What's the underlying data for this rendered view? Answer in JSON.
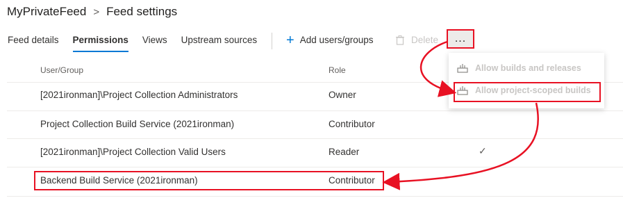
{
  "breadcrumb": {
    "feed": "MyPrivateFeed",
    "separator": ">",
    "page": "Feed settings"
  },
  "tabs": [
    {
      "label": "Feed details"
    },
    {
      "label": "Permissions",
      "active": true
    },
    {
      "label": "Views"
    },
    {
      "label": "Upstream sources"
    }
  ],
  "toolbar": {
    "add_label": "Add users/groups",
    "delete_label": "Delete",
    "more_label": "..."
  },
  "table": {
    "headers": {
      "user": "User/Group",
      "role": "Role"
    },
    "rows": [
      {
        "user": "[2021ironman]\\Project Collection Administrators",
        "role": "Owner"
      },
      {
        "user": "Project Collection Build Service (2021ironman)",
        "role": "Contributor"
      },
      {
        "user": "[2021ironman]\\Project Collection Valid Users",
        "role": "Reader",
        "check": "✓"
      },
      {
        "user": "Backend Build Service (2021ironman)",
        "role": "Contributor"
      }
    ]
  },
  "menu": {
    "items": [
      {
        "label": "Allow builds and releases",
        "icon": "build-icon"
      },
      {
        "label": "Allow project-scoped builds",
        "icon": "build-icon"
      }
    ]
  },
  "colors": {
    "accent": "#0078d4",
    "highlight": "#e81123",
    "disabled": "#c8c6c4"
  }
}
